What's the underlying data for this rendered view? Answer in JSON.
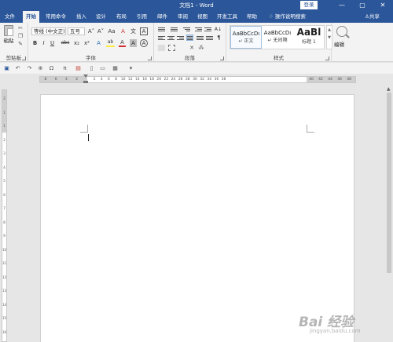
{
  "titlebar": {
    "title": "文档1 - Word",
    "login_label": "登录",
    "min_glyph": "—",
    "restore_glyph": "▢",
    "close_glyph": "✕"
  },
  "tabs": [
    {
      "label": "文件",
      "active": false
    },
    {
      "label": "开始",
      "active": true
    },
    {
      "label": "常用命令",
      "active": false
    },
    {
      "label": "插入",
      "active": false
    },
    {
      "label": "设计",
      "active": false
    },
    {
      "label": "布局",
      "active": false
    },
    {
      "label": "引用",
      "active": false
    },
    {
      "label": "邮件",
      "active": false
    },
    {
      "label": "审阅",
      "active": false
    },
    {
      "label": "视图",
      "active": false
    },
    {
      "label": "开发工具",
      "active": false
    },
    {
      "label": "帮助",
      "active": false
    }
  ],
  "tell_me": {
    "icon": "lightbulb-icon",
    "label": "操作说明搜索"
  },
  "share": {
    "icon": "person-icon",
    "label": "共享"
  },
  "ribbon": {
    "clipboard": {
      "paste_label": "粘贴",
      "group_label": "剪贴板"
    },
    "font": {
      "font_name": "等线 (中文正)",
      "font_size": "五号",
      "grow": "A˄",
      "shrink": "A˅",
      "case": "Aa",
      "clear": "A",
      "phonetic": "文",
      "border_char": "A",
      "bold": "B",
      "italic": "I",
      "underline": "U",
      "strike": "abc",
      "subscript": "x₂",
      "superscript": "x²",
      "effects": "A",
      "highlight": "ab",
      "font_color": "A",
      "shading": "A",
      "enclose": "A",
      "group_label": "字体"
    },
    "paragraph": {
      "group_label": "段落",
      "sort": "A↓",
      "show_marks": "¶"
    },
    "styles": {
      "items": [
        {
          "sample": "AaBbCcDı",
          "name": "↵ 正文",
          "selected": true
        },
        {
          "sample": "AaBbCcDı",
          "name": "↵ 无间隔",
          "selected": false
        },
        {
          "sample": "AaBl",
          "name": "标题 1",
          "selected": false
        }
      ],
      "group_label": "样式"
    },
    "editing": {
      "label": "编辑"
    }
  },
  "ruler": {
    "left_numbers": [
      "8",
      "6",
      "4",
      "2"
    ],
    "numbers": [
      "2",
      "4",
      "6",
      "8",
      "10",
      "12",
      "14",
      "16",
      "18",
      "20",
      "22",
      "24",
      "26",
      "28",
      "30",
      "32",
      "34",
      "36",
      "38"
    ],
    "right_numbers": [
      "40",
      "42",
      "44",
      "46",
      "48"
    ]
  },
  "vruler": {
    "numbers": [
      "2",
      "1",
      "1",
      "2",
      "3",
      "4",
      "5",
      "6",
      "7",
      "8",
      "9",
      "10",
      "11",
      "12",
      "13",
      "14",
      "15",
      "16"
    ]
  },
  "watermark": {
    "text": "Bai 经验",
    "sub": "jingyan.baidu.com"
  }
}
